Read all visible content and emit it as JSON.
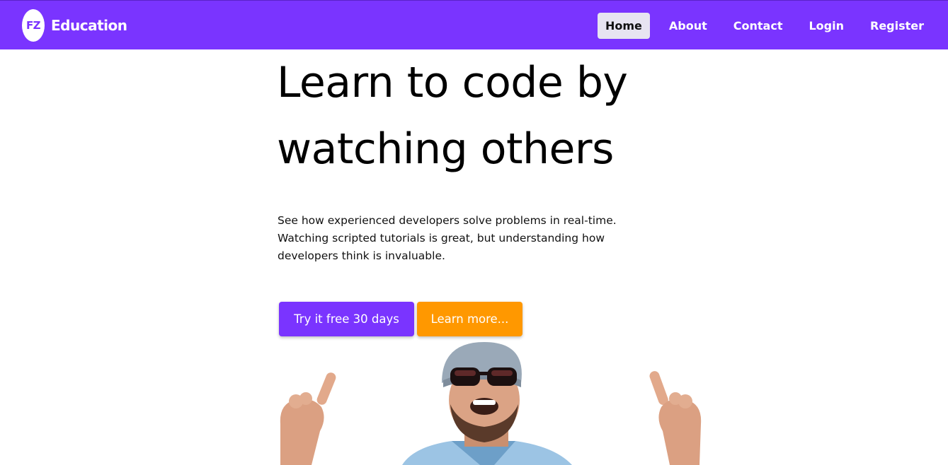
{
  "brand": {
    "logo_text": "FZ",
    "name": "Education"
  },
  "nav": {
    "items": [
      {
        "label": "Home",
        "active": true
      },
      {
        "label": "About",
        "active": false
      },
      {
        "label": "Contact",
        "active": false
      },
      {
        "label": "Login",
        "active": false
      },
      {
        "label": "Register",
        "active": false
      }
    ]
  },
  "hero": {
    "title_line1": "Learn to code by",
    "title_line2": "watching others",
    "text_line1": "See how experienced developers solve problems in real-time.",
    "text_line2": "Watching scripted tutorials is great, but understanding how",
    "text_line3": "developers think is invaluable.",
    "primary_button": "Try it free 30 days",
    "secondary_button": "Learn more..."
  },
  "colors": {
    "brand_purple": "#7a34ff",
    "accent_orange": "#ff9800",
    "active_nav_bg": "#e7e4f1"
  }
}
